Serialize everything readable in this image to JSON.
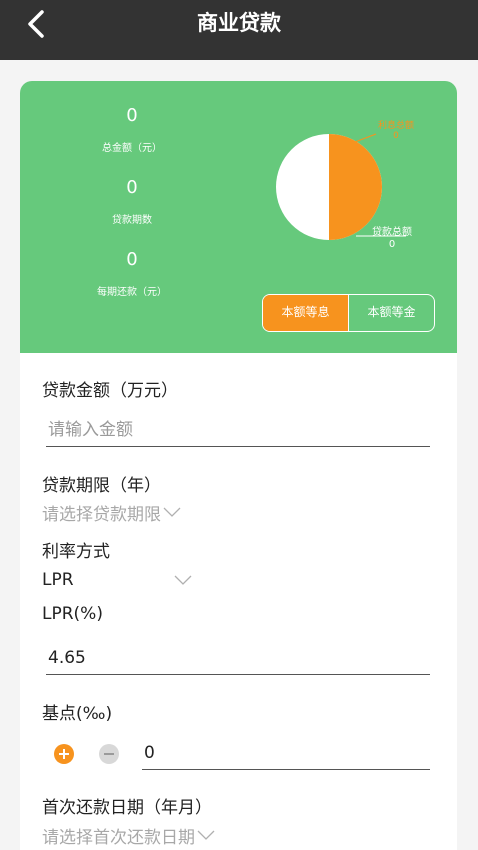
{
  "header": {
    "title": "商业贷款"
  },
  "summary": {
    "total_amount": {
      "value": "0",
      "label": "总金额（元）"
    },
    "loan_periods": {
      "value": "0",
      "label": "贷款期数"
    },
    "monthly_payment": {
      "value": "0",
      "label": "每期还款（元）"
    },
    "pie": {
      "interest_label": "利息总额",
      "interest_value": "0",
      "principal_label": "贷款总额",
      "principal_value": "0",
      "interest_color": "#f7931e",
      "principal_color": "#ffffff"
    },
    "methods": [
      "本额等息",
      "本额等金"
    ],
    "selected_method": "本额等息"
  },
  "form": {
    "loan_amount": {
      "label": "贷款金额（万元）",
      "placeholder": "请输入金额",
      "value": ""
    },
    "loan_term": {
      "label": "贷款期限（年）",
      "placeholder": "请选择贷款期限"
    },
    "rate_mode": {
      "label": "利率方式",
      "value": "LPR"
    },
    "lpr": {
      "label": "LPR(%)",
      "value": "4.65"
    },
    "basis_point": {
      "label": "基点(‰)",
      "value": "0"
    },
    "first_repay_date": {
      "label": "首次还款日期（年月）",
      "placeholder": "请选择首次还款日期"
    }
  },
  "colors": {
    "header": "#333333",
    "card": "#66c97c",
    "accent": "#f7931e"
  }
}
